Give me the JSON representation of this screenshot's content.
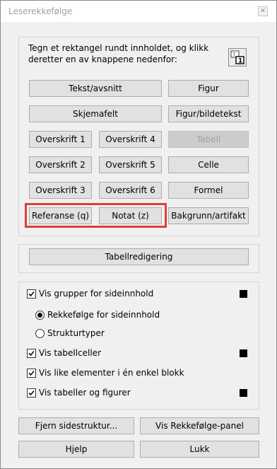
{
  "window": {
    "title": "Leserekkefølge"
  },
  "instruction": "Tegn et rektangel rundt innholdet, og klikk deretter en av knappene nedenfor:",
  "tag_buttons": {
    "text": "Tekst/avsnitt",
    "figure": "Figur",
    "form_field": "Skjemafelt",
    "figure_caption": "Figur/bildetekst",
    "heading1": "Overskrift 1",
    "heading4": "Overskrift 4",
    "table": "Tabell",
    "heading2": "Overskrift 2",
    "heading5": "Overskrift 5",
    "cell": "Celle",
    "heading3": "Overskrift 3",
    "heading6": "Overskrift 6",
    "formula": "Formel",
    "reference": "Referanse (q)",
    "note": "Notat (z)",
    "background": "Bakgrunn/artifakt"
  },
  "table_editor_label": "Tabellredigering",
  "display_options": {
    "show_groups": {
      "label": "Vis grupper for sideinnhold",
      "checked": true
    },
    "radio_order": {
      "label": "Rekkefølge for sideinnhold",
      "selected": true
    },
    "radio_structure": {
      "label": "Strukturtyper",
      "selected": false
    },
    "show_cells": {
      "label": "Vis tabellceller",
      "checked": true
    },
    "show_like": {
      "label": "Vis like elementer i én enkel blokk",
      "checked": true
    },
    "show_tables": {
      "label": "Vis tabeller og figurer",
      "checked": true
    },
    "swatch_color": "#000000"
  },
  "footer": {
    "remove_structure": "Fjern sidestruktur...",
    "show_panel": "Vis Rekkefølge-panel",
    "help": "Hjelp",
    "close": "Lukk"
  },
  "colors": {
    "highlight": "#e03c3c"
  }
}
